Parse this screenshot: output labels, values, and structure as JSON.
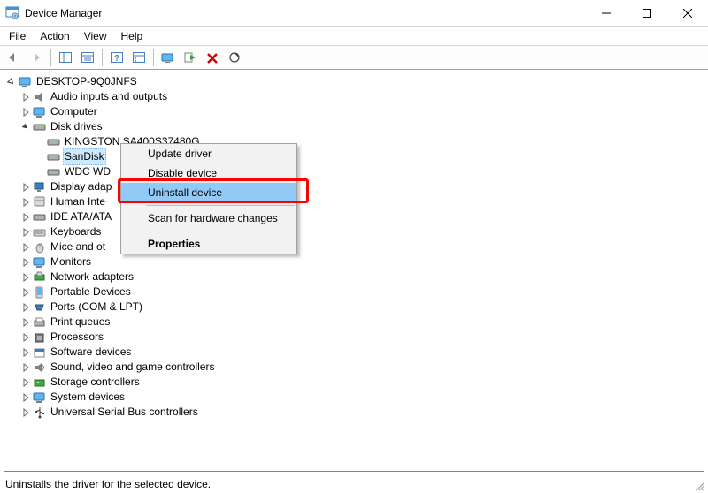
{
  "window": {
    "title": "Device Manager"
  },
  "menu": {
    "file": "File",
    "action": "Action",
    "view": "View",
    "help": "Help"
  },
  "root": "DESKTOP-9Q0JNFS",
  "nodes": {
    "audio": "Audio inputs and outputs",
    "computer": "Computer",
    "diskdrives": "Disk drives",
    "disk0": "KINGSTON SA400S37480G",
    "disk1": "SanDisk",
    "disk2": "WDC WD",
    "display": "Display adap",
    "hid": "Human Inte",
    "ide": "IDE ATA/ATA",
    "keyboards": "Keyboards",
    "mice": "Mice and ot",
    "monitors": "Monitors",
    "network": "Network adapters",
    "portable": "Portable Devices",
    "ports": "Ports (COM & LPT)",
    "printq": "Print queues",
    "processors": "Processors",
    "softdev": "Software devices",
    "sound": "Sound, video and game controllers",
    "storage": "Storage controllers",
    "sysdev": "System devices",
    "usb": "Universal Serial Bus controllers"
  },
  "ctx": {
    "update": "Update driver",
    "disable": "Disable device",
    "uninstall": "Uninstall device",
    "scan": "Scan for hardware changes",
    "properties": "Properties"
  },
  "status": "Uninstalls the driver for the selected device."
}
